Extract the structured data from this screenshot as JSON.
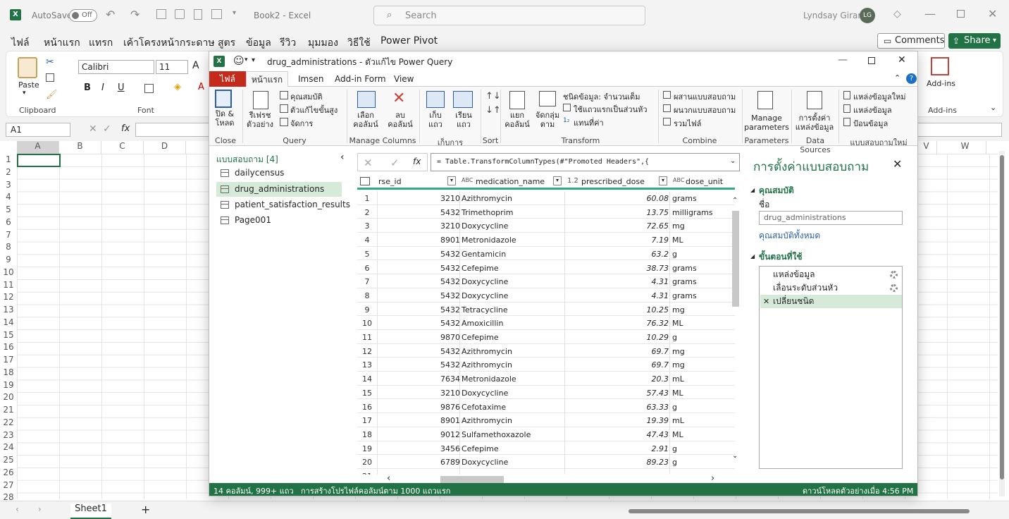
{
  "excel": {
    "autosave_label": "AutoSave",
    "autosave_state": "Off",
    "doc_title": "Book2 - Excel",
    "search_placeholder": "Search",
    "user_name": "Lyndsay Girard",
    "user_initials": "LG",
    "tabs": [
      "ไฟล์",
      "หน้าแรก",
      "แทรก",
      "เค้าโครงหน้ากระดาษ",
      "สูตร",
      "ข้อมูล",
      "รีวิว",
      "มุมมอง",
      "วิธีใช้",
      "Power Pivot"
    ],
    "comments_label": "Comments",
    "share_label": "Share",
    "ribbon": {
      "paste_label": "Paste",
      "clipboard_label": "Clipboard",
      "font_name": "Calibri",
      "font_size": "11",
      "font_group_label": "Font",
      "bold": "B",
      "italic": "I",
      "underline": "U",
      "addins_label": "Add-ins",
      "addins_group_label": "Add-ins"
    },
    "name_box": "A1",
    "fx": "fx",
    "columns": [
      "A",
      "B",
      "C",
      "D",
      "V",
      "W"
    ],
    "rows": [
      "1",
      "2",
      "3",
      "4",
      "5",
      "6",
      "7",
      "8",
      "9",
      "10",
      "11",
      "12",
      "13",
      "14",
      "15",
      "16",
      "17",
      "18",
      "19",
      "20",
      "21",
      "22",
      "23",
      "24",
      "25",
      "26",
      "27",
      "28"
    ],
    "sheet_tab": "Sheet1",
    "add_sheet": "+"
  },
  "pq": {
    "title_file": "drug_administrations",
    "title_app": " - ตัวแก้ไข Power Query",
    "tabs": [
      "ไฟล์",
      "หน้าแรก",
      "Imsen",
      "Add-in Form",
      "View"
    ],
    "ribbon": {
      "close_load": "ปิด &\nโหลด",
      "close_group": "Close",
      "refresh": "รีเฟรช\nตัวอย่าง",
      "properties": "คุณสมบัติ",
      "adv_editor": "ตัวแก้ไขขั้นสูง",
      "manage": "จัดการ",
      "query_group": "Query",
      "choose_cols": "เลือก\nคอลัมน์",
      "remove_cols": "ลบ\nคอลัมน์",
      "manage_cols_group": "Manage Columns",
      "keep_rows": "เก็บ\nแถว",
      "remove_rows": "เรียนแถว",
      "rows_group": "เก็บการ",
      "sort_group": "Sort",
      "split_col": "แยก\nคอลัมน์",
      "group_by": "จัดกลุ่ม\nตาม",
      "data_type": "ชนิดข้อมูล: จำนวนเต็ม",
      "first_row_header": "ใช้แถวแรกเป็นส่วนหัว",
      "replace_values": "แทนที่ค่า",
      "transform_group": "Transform",
      "merge_queries": "ผสานแบบสอบถาม",
      "append_queries": "ผนวกแบบสอบถาม",
      "combine_files": "รวมไฟล์",
      "combine_group": "Combine",
      "manage_params": "Manage\nparameters",
      "params_group": "Parameters",
      "ds_settings": "การตั้งค่า\nแหล่งข้อมูล",
      "ds_group": "Data Sources",
      "new_source": "แหล่งข้อมูลใหม่",
      "recent_source": "แหล่งข้อมูล",
      "enter_data": "ป้อนข้อมูล",
      "new_query_group": "แบบสอบถามใหม่"
    },
    "queries_header": "แบบสอบถาม [4]",
    "queries": [
      "dailycensus",
      "drug_administrations",
      "patient_satisfaction_results",
      "Page001"
    ],
    "formula": "= Table.TransformColumnTypes(#\"Promoted Headers\",{",
    "columns": [
      {
        "name": "rse_id",
        "type": ""
      },
      {
        "name": "medication_name",
        "type": "ABC"
      },
      {
        "name": "prescribed_dose",
        "type": "1.2"
      },
      {
        "name": "dose_unit",
        "type": "ABC"
      }
    ],
    "rows": [
      [
        "1",
        "3210",
        "Azithromycin",
        "60.08",
        "grams"
      ],
      [
        "2",
        "5432",
        "Trimethoprim",
        "13.75",
        "milligrams"
      ],
      [
        "3",
        "3210",
        "Doxycycline",
        "72.65",
        "mg"
      ],
      [
        "4",
        "8901",
        "Metronidazole",
        "7.19",
        "ML"
      ],
      [
        "5",
        "5432",
        "Gentamicin",
        "63.2",
        "g"
      ],
      [
        "6",
        "5432",
        "Cefepime",
        "38.73",
        "grams"
      ],
      [
        "7",
        "5432",
        "Doxycycline",
        "4.31",
        "grams"
      ],
      [
        "8",
        "5432",
        "Doxycycline",
        "4.31",
        "grams"
      ],
      [
        "9",
        "5432",
        "Tetracycline",
        "10.25",
        "mg"
      ],
      [
        "10",
        "5432",
        "Amoxicillin",
        "76.32",
        "ML"
      ],
      [
        "11",
        "9870",
        "Cefepime",
        "10.29",
        "g"
      ],
      [
        "12",
        "5432",
        "Azithromycin",
        "69.7",
        "mg"
      ],
      [
        "13",
        "5432",
        "Azithromycin",
        "69.7",
        "mg"
      ],
      [
        "14",
        "7634",
        "Metronidazole",
        "20.3",
        "mL"
      ],
      [
        "15",
        "3210",
        "Doxycycline",
        "57.43",
        "ML"
      ],
      [
        "16",
        "9876",
        "Cefotaxime",
        "63.33",
        "g"
      ],
      [
        "17",
        "8901",
        "Azithromycin",
        "19.39",
        "mL"
      ],
      [
        "18",
        "9012",
        "Sulfamethoxazole",
        "47.43",
        "ML"
      ],
      [
        "19",
        "3456",
        "Cefepime",
        "2.91",
        "g"
      ],
      [
        "20",
        "6789",
        "Doxycycline",
        "89.23",
        "g"
      ],
      [
        "21",
        "",
        "",
        "",
        ""
      ]
    ],
    "settings_title": "การตั้งค่าแบบสอบถาม",
    "props_header": "คุณสมบัติ",
    "name_label": "ชื่อ",
    "name_value": "drug_administrations",
    "all_props_link": "คุณสมบัติทั้งหมด",
    "steps_header": "ขั้นตอนที่ใช้",
    "steps": [
      "แหล่งข้อมูล",
      "เลื่อนระดับส่วนหัว",
      "เปลี่ยนชนิด"
    ],
    "status_left": "14 คอลัมน์, 999+ แถว",
    "status_mid": "การสร้างโปรไฟล์คอลัมน์ตาม 1000 แถวแรก",
    "status_right": "ดาวน์โหลดตัวอย่างเมื่อ 4:56 PM"
  },
  "colors": {
    "excel_green": "#217346",
    "pq_file_tab": "#c42b1c",
    "selected": "#d5ead9"
  }
}
